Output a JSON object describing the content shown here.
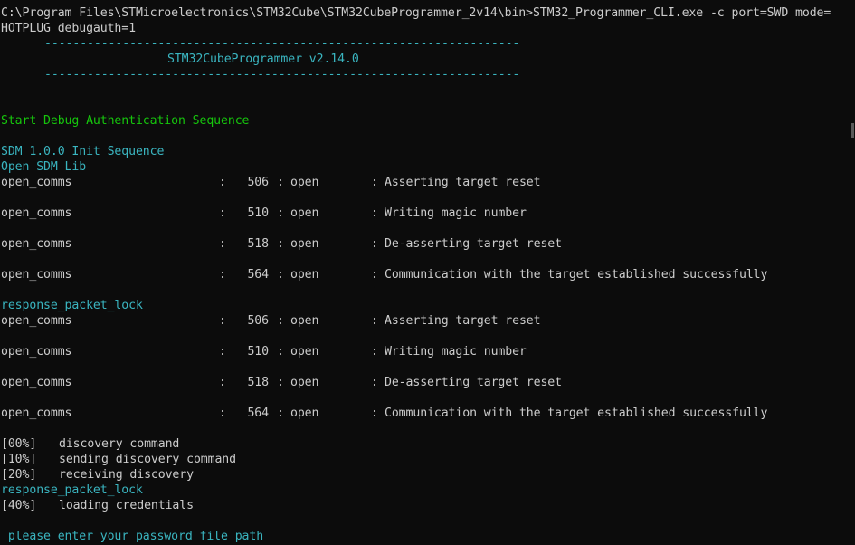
{
  "terminal": {
    "command_line_1": "C:\\Program Files\\STMicroelectronics\\STM32Cube\\STM32CubeProgrammer_2v14\\bin>STM32_Programmer_CLI.exe -c port=SWD mode=",
    "command_line_2": "HOTPLUG debugauth=1",
    "banner_rule": "-------------------------------------------------------------------",
    "banner_title": "STM32CubeProgrammer v2.14.0",
    "start_sequence": "Start Debug Authentication Sequence",
    "sdm_init": "SDM 1.0.0 Init Sequence",
    "open_sdm_lib": "Open SDM Lib",
    "group1": [
      {
        "name": "open_comms",
        "sep": ":",
        "num": "506",
        "state": "open",
        "msg": "Asserting target reset"
      },
      {
        "name": "open_comms",
        "sep": ":",
        "num": "510",
        "state": "open",
        "msg": "Writing magic number"
      },
      {
        "name": "open_comms",
        "sep": ":",
        "num": "518",
        "state": "open",
        "msg": "De-asserting target reset"
      },
      {
        "name": "open_comms",
        "sep": ":",
        "num": "564",
        "state": "open",
        "msg": "Communication with the target established successfully"
      }
    ],
    "response_packet_lock_1": "response_packet_lock",
    "group2": [
      {
        "name": "open_comms",
        "sep": ":",
        "num": "506",
        "state": "open",
        "msg": "Asserting target reset"
      },
      {
        "name": "open_comms",
        "sep": ":",
        "num": "510",
        "state": "open",
        "msg": "Writing magic number"
      },
      {
        "name": "open_comms",
        "sep": ":",
        "num": "518",
        "state": "open",
        "msg": "De-asserting target reset"
      },
      {
        "name": "open_comms",
        "sep": ":",
        "num": "564",
        "state": "open",
        "msg": "Communication with the target established successfully"
      }
    ],
    "progress": [
      {
        "pct": "[00%]",
        "text": "discovery command"
      },
      {
        "pct": "[10%]",
        "text": "sending discovery command"
      },
      {
        "pct": "[20%]",
        "text": "receiving discovery"
      }
    ],
    "response_packet_lock_2": "response_packet_lock",
    "progress2": {
      "pct": "[40%]",
      "text": "loading credentials"
    },
    "prompt": " please enter your password file path"
  },
  "colors": {
    "background": "#0c0c0c",
    "text": "#cccccc",
    "cyan": "#3ab5c0",
    "green": "#16c60c"
  }
}
